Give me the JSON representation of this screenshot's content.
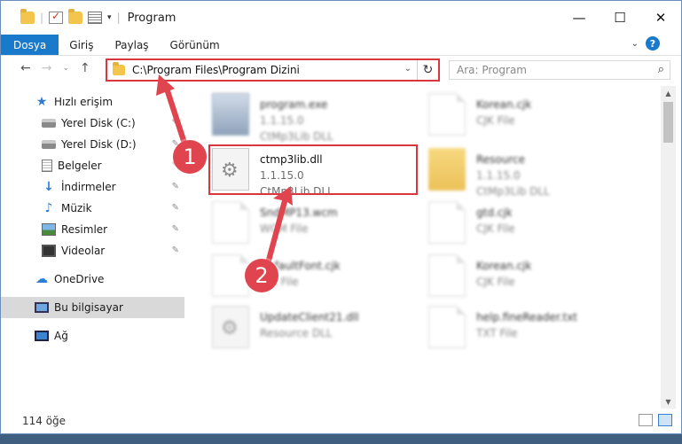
{
  "window": {
    "title": "Program",
    "controls": {
      "minimize": "—",
      "maximize": "☐",
      "close": "✕"
    }
  },
  "ribbon": {
    "tabs": [
      {
        "label": "Dosya"
      },
      {
        "label": "Giriş"
      },
      {
        "label": "Paylaş"
      },
      {
        "label": "Görünüm"
      }
    ],
    "help_label": "?"
  },
  "address": {
    "path": "C:\\Program Files\\Program Dizini",
    "search_placeholder": "Ara: Program"
  },
  "nav": {
    "items": [
      {
        "label": "Hızlı erişim"
      },
      {
        "label": "Yerel Disk (C:)"
      },
      {
        "label": "Yerel Disk (D:)"
      },
      {
        "label": "Belgeler"
      },
      {
        "label": "İndirmeler"
      },
      {
        "label": "Müzik"
      },
      {
        "label": "Resimler"
      },
      {
        "label": "Videolar"
      },
      {
        "label": "OneDrive"
      },
      {
        "label": "Bu bilgisayar"
      },
      {
        "label": "Ağ"
      }
    ]
  },
  "files": [
    {
      "name": "program.exe",
      "line1": "1.1.15.0",
      "line2": "CtMp3Lib DLL"
    },
    {
      "name": "Korean.cjk",
      "line1": "CJK File",
      "line2": ""
    },
    {
      "name": "ctmp3lib.dll",
      "line1": "1.1.15.0",
      "line2": "CtMp3Lib DLL"
    },
    {
      "name": "Resource",
      "line1": "1.1.15.0",
      "line2": "CtMp3Lib DLL"
    },
    {
      "name": "SndMP13.wcm",
      "line1": "WCM File",
      "line2": ""
    },
    {
      "name": "gtd.cjk",
      "line1": "CJK File",
      "line2": ""
    },
    {
      "name": "DefaultFont.cjk",
      "line1": "CJK File",
      "line2": ""
    },
    {
      "name": "Korean.cjk",
      "line1": "CJK File",
      "line2": ""
    },
    {
      "name": "UpdateClient21.dll",
      "line1": "Resource DLL",
      "line2": ""
    },
    {
      "name": "help.fineReader.txt",
      "line1": "TXT File",
      "line2": ""
    }
  ],
  "status": {
    "count": "114 öğe"
  },
  "annotations": {
    "step1": "1",
    "step2": "2"
  },
  "colors": {
    "accent": "#1979ca",
    "highlight": "#d9363e",
    "badge": "#e0444e"
  }
}
